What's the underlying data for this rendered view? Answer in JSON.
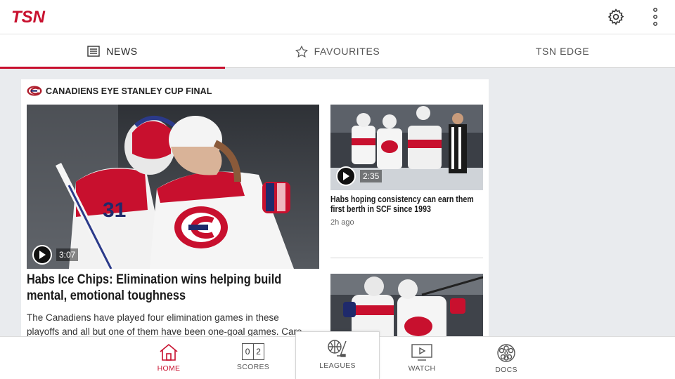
{
  "app": {
    "logo_text": "TSN",
    "brand_color": "#c8102e"
  },
  "top_actions": {
    "settings_icon": "gear-icon",
    "more_icon": "vertical-dots-icon"
  },
  "tabs": [
    {
      "label": "NEWS",
      "icon": "newspaper-icon",
      "active": true
    },
    {
      "label": "FAVOURITES",
      "icon": "star-icon",
      "active": false
    },
    {
      "label": "TSN EDGE",
      "active": false
    }
  ],
  "section": {
    "title": "CANADIENS EYE STANLEY CUP FINAL",
    "team_icon": "canadiens-logo-icon",
    "main_story": {
      "duration": "3:07",
      "headline": "Habs Ice Chips: Elimination wins helping build mental, emotional toughness",
      "summary": "The Canadiens have played four elimination games in these playoffs and all but one of them have been one-goal games. Care"
    },
    "side_story": {
      "duration": "2:35",
      "headline": "Habs hoping consistency can earn them first berth in SCF since 1993",
      "time_ago": "2h ago"
    }
  },
  "bottom_nav": [
    {
      "label": "HOME",
      "icon": "home-icon",
      "active": true
    },
    {
      "label": "SCORES",
      "icon": "scoreboard-icon",
      "score_left": "0",
      "score_right": "2"
    },
    {
      "label": "LEAGUES",
      "icon": "hockey-basketball-icon"
    },
    {
      "label": "WATCH",
      "icon": "play-screen-icon"
    },
    {
      "label": "DOCS",
      "icon": "film-reel-icon"
    }
  ]
}
